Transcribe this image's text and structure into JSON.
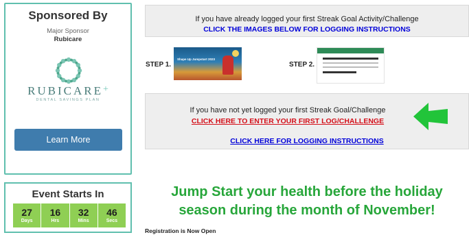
{
  "sponsor": {
    "title": "Sponsored By",
    "subtitle": "Major Sponsor",
    "name": "Rubicare",
    "logo_word": "RUBICARE",
    "logo_plus": "+",
    "logo_tagline": "DENTAL SAVINGS PLAN",
    "learn_more_label": "Learn More",
    "accent_color": "#5fbfae",
    "button_color": "#3f7cad"
  },
  "event": {
    "title": "Event Starts In",
    "countdown": [
      {
        "value": "27",
        "unit": "Days"
      },
      {
        "value": "16",
        "unit": "Hrs"
      },
      {
        "value": "32",
        "unit": "Mins"
      },
      {
        "value": "46",
        "unit": "Secs"
      }
    ],
    "countdown_color": "#8fcf54"
  },
  "logged_box": {
    "line1": "If you have already logged your first Streak Goal Activity/Challenge",
    "link": "CLICK THE IMAGES BELOW FOR LOGGING INSTRUCTIONS"
  },
  "steps": [
    {
      "label": "STEP 1.",
      "thumb_title": "Shape Up Jumpstart 2023"
    },
    {
      "label": "STEP 2."
    }
  ],
  "not_logged_box": {
    "line1": "If you have not yet logged your first Streak Goal/Challenge",
    "red_link": "CLICK HERE TO ENTER YOUR FIRST LOG/CHALLENGE",
    "blue_link": "CLICK HERE FOR LOGGING INSTRUCTIONS",
    "arrow_icon": "green-arrow-left-icon"
  },
  "headline": {
    "line1": "Jump Start your health before the holiday",
    "line2": "season during the month of November!",
    "color": "#27a63a"
  },
  "registration_text": "Registration is Now Open"
}
